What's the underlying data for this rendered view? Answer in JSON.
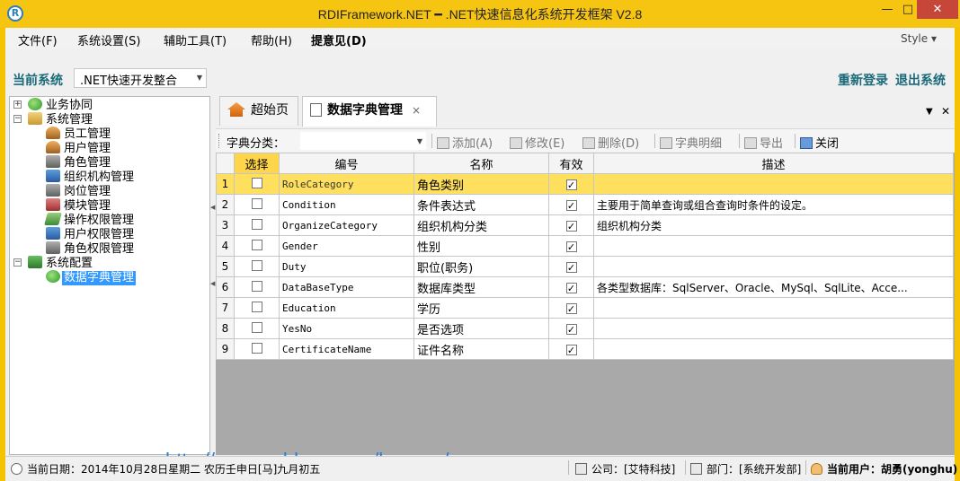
{
  "window": {
    "title": "RDIFramework.NET ━ .NET快速信息化系统开发框架 V2.8",
    "min": "—",
    "max": "□",
    "close": "✕"
  },
  "menu": {
    "items": [
      "文件(F)",
      "系统设置(S)",
      "辅助工具(T)",
      "帮助(H)",
      "提意见(D)"
    ],
    "style": "Style ▾"
  },
  "system_bar": {
    "label": "当前系统",
    "selected": ".NET快速开发整合",
    "relogin": "重新登录",
    "logout": "退出系统"
  },
  "tree": {
    "nodes": [
      {
        "label": "业务协同",
        "level": 0,
        "expander": "+",
        "icon": "globe-icon"
      },
      {
        "label": "系统管理",
        "level": 0,
        "expander": "−",
        "icon": "folder-icon"
      },
      {
        "label": "员工管理",
        "level": 1,
        "icon": "staff-icon"
      },
      {
        "label": "用户管理",
        "level": 1,
        "icon": "user-icon"
      },
      {
        "label": "角色管理",
        "level": 1,
        "icon": "role-icon"
      },
      {
        "label": "组织机构管理",
        "level": 1,
        "icon": "org-icon"
      },
      {
        "label": "岗位管理",
        "level": 1,
        "icon": "post-icon"
      },
      {
        "label": "模块管理",
        "level": 1,
        "icon": "module-icon"
      },
      {
        "label": "操作权限管理",
        "level": 1,
        "icon": "permission-icon"
      },
      {
        "label": "用户权限管理",
        "level": 1,
        "icon": "user-permission-icon"
      },
      {
        "label": "角色权限管理",
        "level": 1,
        "icon": "role-permission-icon"
      },
      {
        "label": "系统配置",
        "level": 0,
        "expander": "−",
        "icon": "config-icon"
      },
      {
        "label": "数据字典管理",
        "level": 1,
        "icon": "dictionary-icon",
        "selected": true
      }
    ]
  },
  "tabs": [
    {
      "label": "超始页",
      "icon": "home-icon",
      "active": false
    },
    {
      "label": "数据字典管理",
      "icon": "document-icon",
      "active": true,
      "close": "×"
    }
  ],
  "tab_strip": {
    "dropdown": "▼",
    "close": "✕"
  },
  "toolbar": {
    "category_label": "字典分类：",
    "category_value": "",
    "add": "添加(A)",
    "edit": "修改(E)",
    "delete": "删除(D)",
    "details": "字典明细",
    "export": "导出",
    "close": "关闭"
  },
  "grid": {
    "columns": [
      "",
      "选择",
      "编号",
      "名称",
      "有效",
      "描述"
    ],
    "rows": [
      {
        "num": "1",
        "checked": false,
        "code": "RoleCategory",
        "name": "角色类别",
        "valid": true,
        "desc": ""
      },
      {
        "num": "2",
        "checked": false,
        "code": "Condition",
        "name": "条件表达式",
        "valid": true,
        "desc": "主要用于简单查询或组合查询时条件的设定。"
      },
      {
        "num": "3",
        "checked": false,
        "code": "OrganizeCategory",
        "name": "组织机构分类",
        "valid": true,
        "desc": "组织机构分类"
      },
      {
        "num": "4",
        "checked": false,
        "code": "Gender",
        "name": "性别",
        "valid": true,
        "desc": ""
      },
      {
        "num": "5",
        "checked": false,
        "code": "Duty",
        "name": "职位(职务)",
        "valid": true,
        "desc": ""
      },
      {
        "num": "6",
        "checked": false,
        "code": "DataBaseType",
        "name": "数据库类型",
        "valid": true,
        "desc": "各类型数据库：SqlServer、Oracle、MySql、SqlLite、Acce..."
      },
      {
        "num": "7",
        "checked": false,
        "code": "Education",
        "name": "学历",
        "valid": true,
        "desc": ""
      },
      {
        "num": "8",
        "checked": false,
        "code": "YesNo",
        "name": "是否选项",
        "valid": true,
        "desc": ""
      },
      {
        "num": "9",
        "checked": false,
        "code": "CertificateName",
        "name": "证件名称",
        "valid": true,
        "desc": ""
      }
    ]
  },
  "watermark": "http://www.cnblogs.com/huyong/",
  "status": {
    "date": "当前日期：2014年10月28日星期二 农历壬申日[马]九月初五",
    "company": "公司：[艾特科技]",
    "department": "部门：[系统开发部]",
    "user": "当前用户：胡勇(yonghu)"
  },
  "colors": {
    "titlebar": "#f6c511",
    "accent_text": "#1a6a7a",
    "selected_row": "#ffdf5e",
    "link": "#2c7ecf",
    "close_button": "#c7463a"
  }
}
